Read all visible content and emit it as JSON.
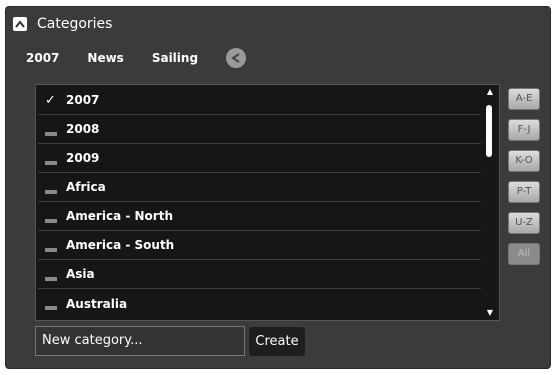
{
  "header": {
    "title": "Categories",
    "toggle_icon": "collapse-up-arrow-icon"
  },
  "selected_tags": [
    "2007",
    "News",
    "Sailing"
  ],
  "clear_icon": "clear-tags-icon",
  "list": {
    "items": [
      {
        "label": "2007",
        "checked": true
      },
      {
        "label": "2008",
        "checked": false
      },
      {
        "label": "2009",
        "checked": false
      },
      {
        "label": "Africa",
        "checked": false
      },
      {
        "label": "America - North",
        "checked": false
      },
      {
        "label": "America - South",
        "checked": false
      },
      {
        "label": "Asia",
        "checked": false
      },
      {
        "label": "Australia",
        "checked": false
      }
    ],
    "checkmark": "✓"
  },
  "az_buttons": [
    {
      "label": "A-E",
      "enabled": true
    },
    {
      "label": "F-J",
      "enabled": true
    },
    {
      "label": "K-O",
      "enabled": true
    },
    {
      "label": "P-T",
      "enabled": true
    },
    {
      "label": "U-Z",
      "enabled": true
    },
    {
      "label": "All",
      "enabled": false
    }
  ],
  "new_category": {
    "placeholder": "New category..."
  },
  "create_label": "Create",
  "colors": {
    "panel": "#3b3b3b",
    "list_bg": "#161616",
    "text": "#ffffff"
  }
}
